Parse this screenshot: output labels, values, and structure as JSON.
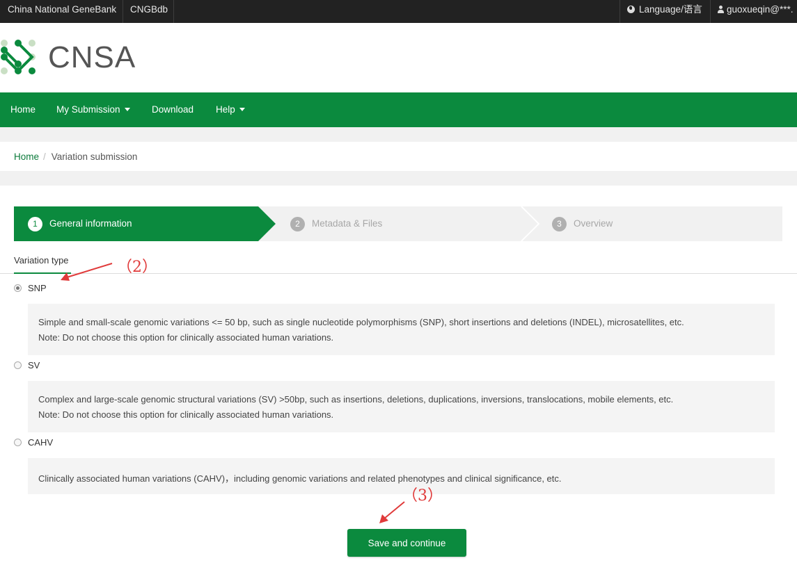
{
  "topbar": {
    "site_name": "China National GeneBank",
    "db_name": "CNGBdb",
    "language": "Language/语言",
    "user": "guoxueqin@***."
  },
  "logo": {
    "text": "CNSA",
    "brand_color": "#0b8a3e"
  },
  "nav": {
    "home": "Home",
    "my_submission": "My Submission",
    "download": "Download",
    "help": "Help"
  },
  "breadcrumb": {
    "home": "Home",
    "separator": "/",
    "current": "Variation submission"
  },
  "steps": [
    {
      "num": "1",
      "label": "General information",
      "state": "active"
    },
    {
      "num": "2",
      "label": "Metadata & Files",
      "state": "inactive"
    },
    {
      "num": "3",
      "label": "Overview",
      "state": "inactive"
    }
  ],
  "variation_type": {
    "label": "Variation type",
    "options": [
      {
        "value": "SNP",
        "selected": true,
        "desc1": "Simple and small-scale genomic variations <= 50 bp, such as single nucleotide polymorphisms (SNP), short insertions and deletions (INDEL), microsatellites, etc.",
        "desc2": "Note: Do not choose this option for clinically associated human variations."
      },
      {
        "value": "SV",
        "selected": false,
        "desc1": "Complex and large-scale genomic structural variations (SV) >50bp, such as insertions, deletions, duplications, inversions, translocations, mobile elements, etc.",
        "desc2": "Note: Do not choose this option for clinically associated human variations."
      },
      {
        "value": "CAHV",
        "selected": false,
        "desc1": "Clinically associated human variations (CAHV)，including genomic variations and related phenotypes and clinical significance, etc."
      }
    ]
  },
  "save_button": "Save and continue",
  "annotations": {
    "a2": "（2）",
    "a3": "（3）",
    "color": "#e03a3a"
  }
}
